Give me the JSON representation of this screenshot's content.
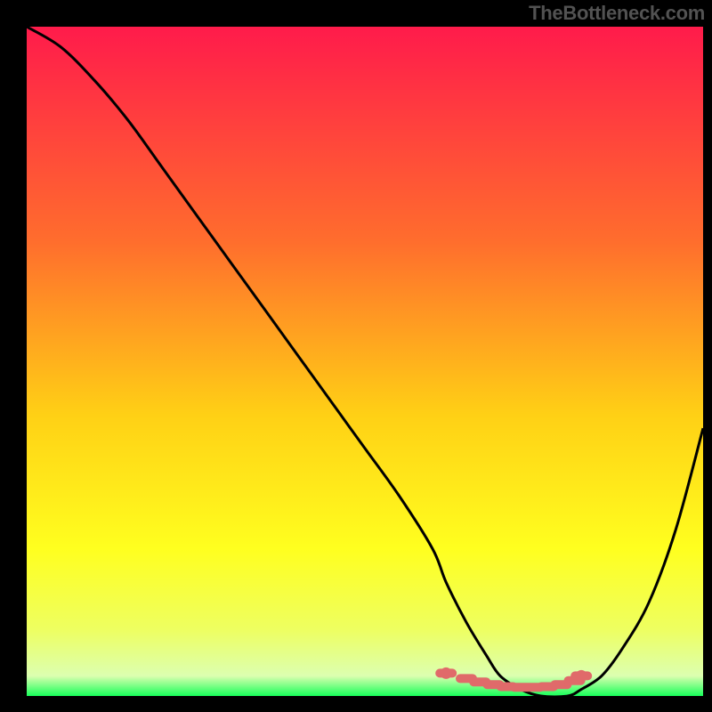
{
  "watermark": "TheBottleneck.com",
  "colors": {
    "top": "#ff1b4b",
    "mid_upper": "#ff6d2d",
    "mid": "#ffd015",
    "mid_lower": "#ffff1f",
    "near_bottom": "#eeff60",
    "bottom_pale": "#dcffb0",
    "bottom": "#18ff5a",
    "background": "#000000",
    "curve": "#000000",
    "marker": "#e06a6a"
  },
  "chart_data": {
    "type": "line",
    "title": "",
    "xlabel": "",
    "ylabel": "",
    "xlim": [
      0,
      100
    ],
    "ylim": [
      0,
      100
    ],
    "series": [
      {
        "name": "bottleneck-curve",
        "x": [
          0,
          5,
          10,
          15,
          20,
          25,
          30,
          35,
          40,
          45,
          50,
          55,
          60,
          62,
          65,
          68,
          70,
          73,
          76,
          80,
          82,
          85,
          88,
          92,
          96,
          100
        ],
        "values": [
          100,
          97,
          92,
          86,
          79,
          72,
          65,
          58,
          51,
          44,
          37,
          30,
          22,
          17,
          11,
          6,
          3,
          1,
          0,
          0,
          1,
          3,
          7,
          14,
          25,
          40
        ]
      }
    ],
    "markers": {
      "x": [
        62,
        65,
        67,
        69,
        71,
        73,
        75,
        77,
        79,
        81,
        82
      ],
      "values": [
        3.4,
        2.6,
        2.1,
        1.7,
        1.4,
        1.3,
        1.3,
        1.4,
        1.7,
        2.3,
        3.0
      ]
    }
  }
}
